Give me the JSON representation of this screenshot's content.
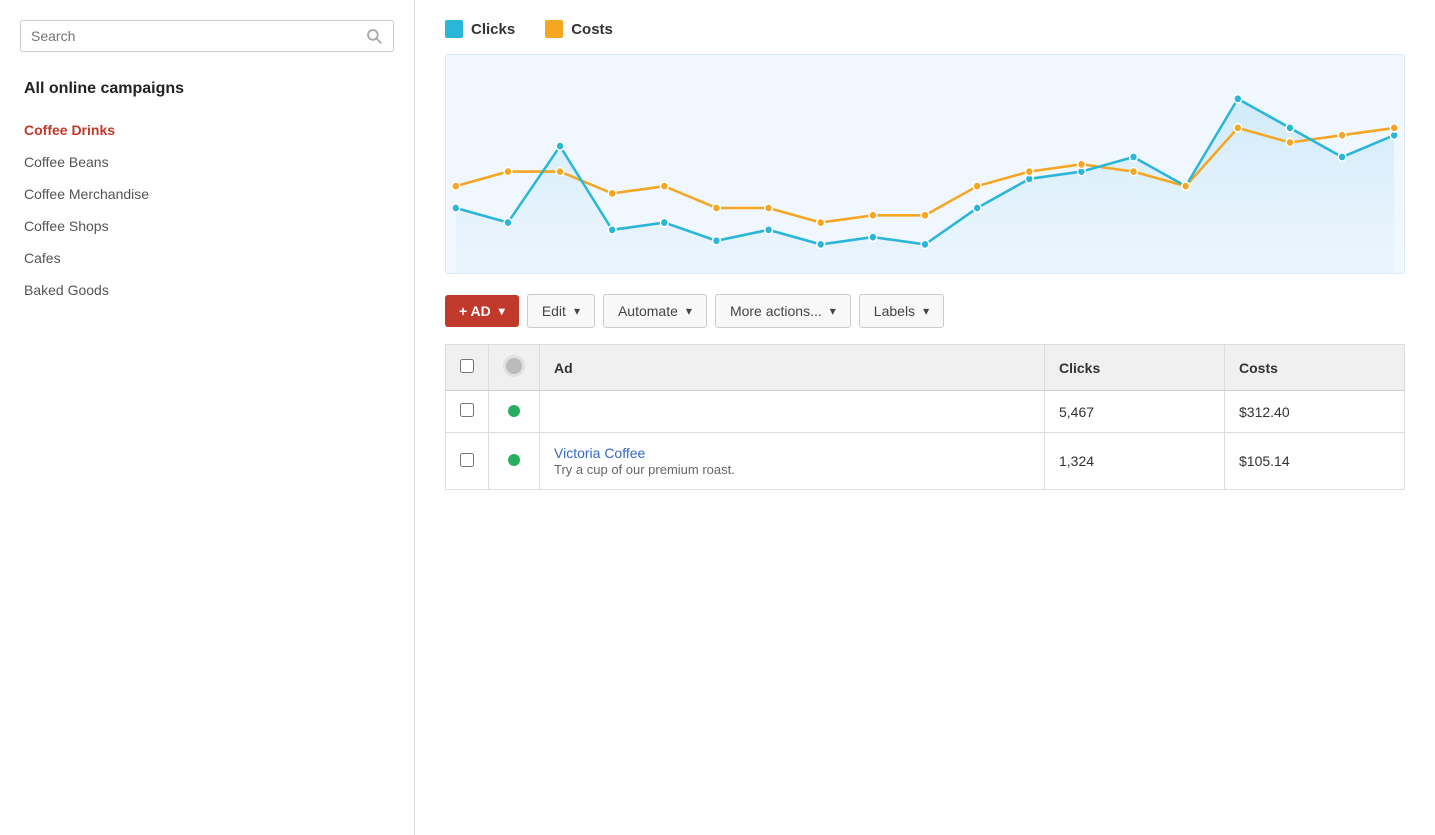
{
  "sidebar": {
    "search_placeholder": "Search",
    "title": "All online campaigns",
    "items": [
      {
        "id": "coffee-drinks",
        "label": "Coffee Drinks",
        "active": true
      },
      {
        "id": "coffee-beans",
        "label": "Coffee Beans",
        "active": false
      },
      {
        "id": "coffee-merchandise",
        "label": "Coffee Merchandise",
        "active": false
      },
      {
        "id": "coffee-shops",
        "label": "Coffee Shops",
        "active": false
      },
      {
        "id": "cafes",
        "label": "Cafes",
        "active": false
      },
      {
        "id": "baked-goods",
        "label": "Baked Goods",
        "active": false
      }
    ]
  },
  "legend": {
    "clicks_label": "Clicks",
    "costs_label": "Costs",
    "clicks_color": "#29b6d8",
    "costs_color": "#f5a623"
  },
  "toolbar": {
    "add_ad_label": "+ AD",
    "edit_label": "Edit",
    "automate_label": "Automate",
    "more_actions_label": "More actions...",
    "labels_label": "Labels"
  },
  "table": {
    "headers": {
      "checkbox": "",
      "status": "",
      "ad": "Ad",
      "clicks": "Clicks",
      "costs": "Costs"
    },
    "rows": [
      {
        "id": "row1",
        "status": "active",
        "ad_name": "",
        "ad_description": "",
        "clicks": "5,467",
        "costs": "$312.40",
        "is_link": false
      },
      {
        "id": "row2",
        "status": "active",
        "ad_name": "Victoria Coffee",
        "ad_description": "Try a cup of our premium roast.",
        "clicks": "1,324",
        "costs": "$105.14",
        "is_link": true
      }
    ]
  },
  "chart": {
    "clicks_data": [
      38,
      34,
      55,
      32,
      34,
      29,
      32,
      28,
      30,
      28,
      38,
      46,
      48,
      52,
      44,
      68,
      60,
      52,
      58
    ],
    "costs_data": [
      44,
      48,
      48,
      42,
      44,
      38,
      38,
      34,
      36,
      36,
      44,
      48,
      50,
      48,
      44,
      60,
      56,
      58,
      60
    ],
    "clicks_color": "#29b6d8",
    "costs_color": "#f5a623"
  }
}
